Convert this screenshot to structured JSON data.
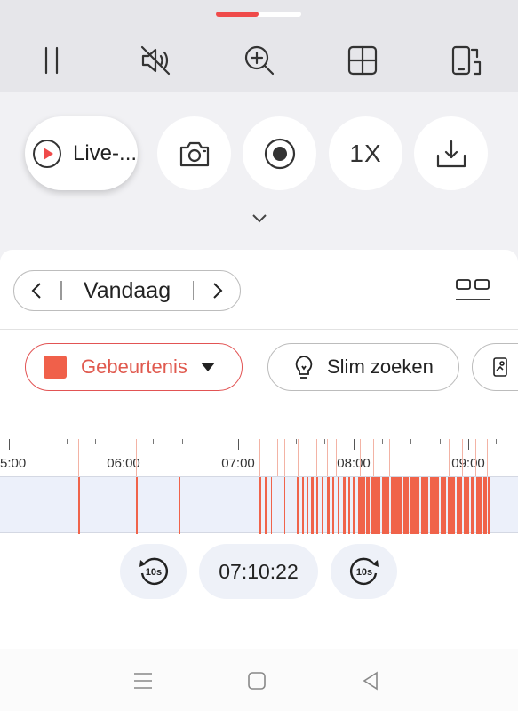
{
  "player": {
    "progress_percent": 50,
    "progress_color": "#ef4a4a",
    "toolbar_icons": [
      "pause-icon",
      "mute-icon",
      "zoom-in-icon",
      "grid-layout-icon",
      "rotate-screen-icon"
    ]
  },
  "controls": {
    "live_label": "Live-...",
    "speed_label": "1X",
    "icons": [
      "play-circle-icon",
      "camera-icon",
      "record-icon",
      "download-icon",
      "chevron-down-icon"
    ]
  },
  "date_selector": {
    "label": "Vandaag",
    "prev_icon": "chevron-left-icon",
    "next_icon": "chevron-right-icon"
  },
  "filters": {
    "event_label": "Gebeurtenis",
    "event_color": "#f0604a",
    "smart_search_label": "Slim zoeken"
  },
  "timeline": {
    "labels": [
      "5:00",
      "06:00",
      "07:00",
      "08:00",
      "09:00"
    ],
    "event_color": "#f0634a",
    "track_color": "#ecf0fa"
  },
  "playback": {
    "current_time": "07:10:22",
    "rewind_label": "10s",
    "forward_label": "10s"
  },
  "navbar": {
    "icons": [
      "menu-icon",
      "home-icon",
      "back-icon"
    ]
  }
}
